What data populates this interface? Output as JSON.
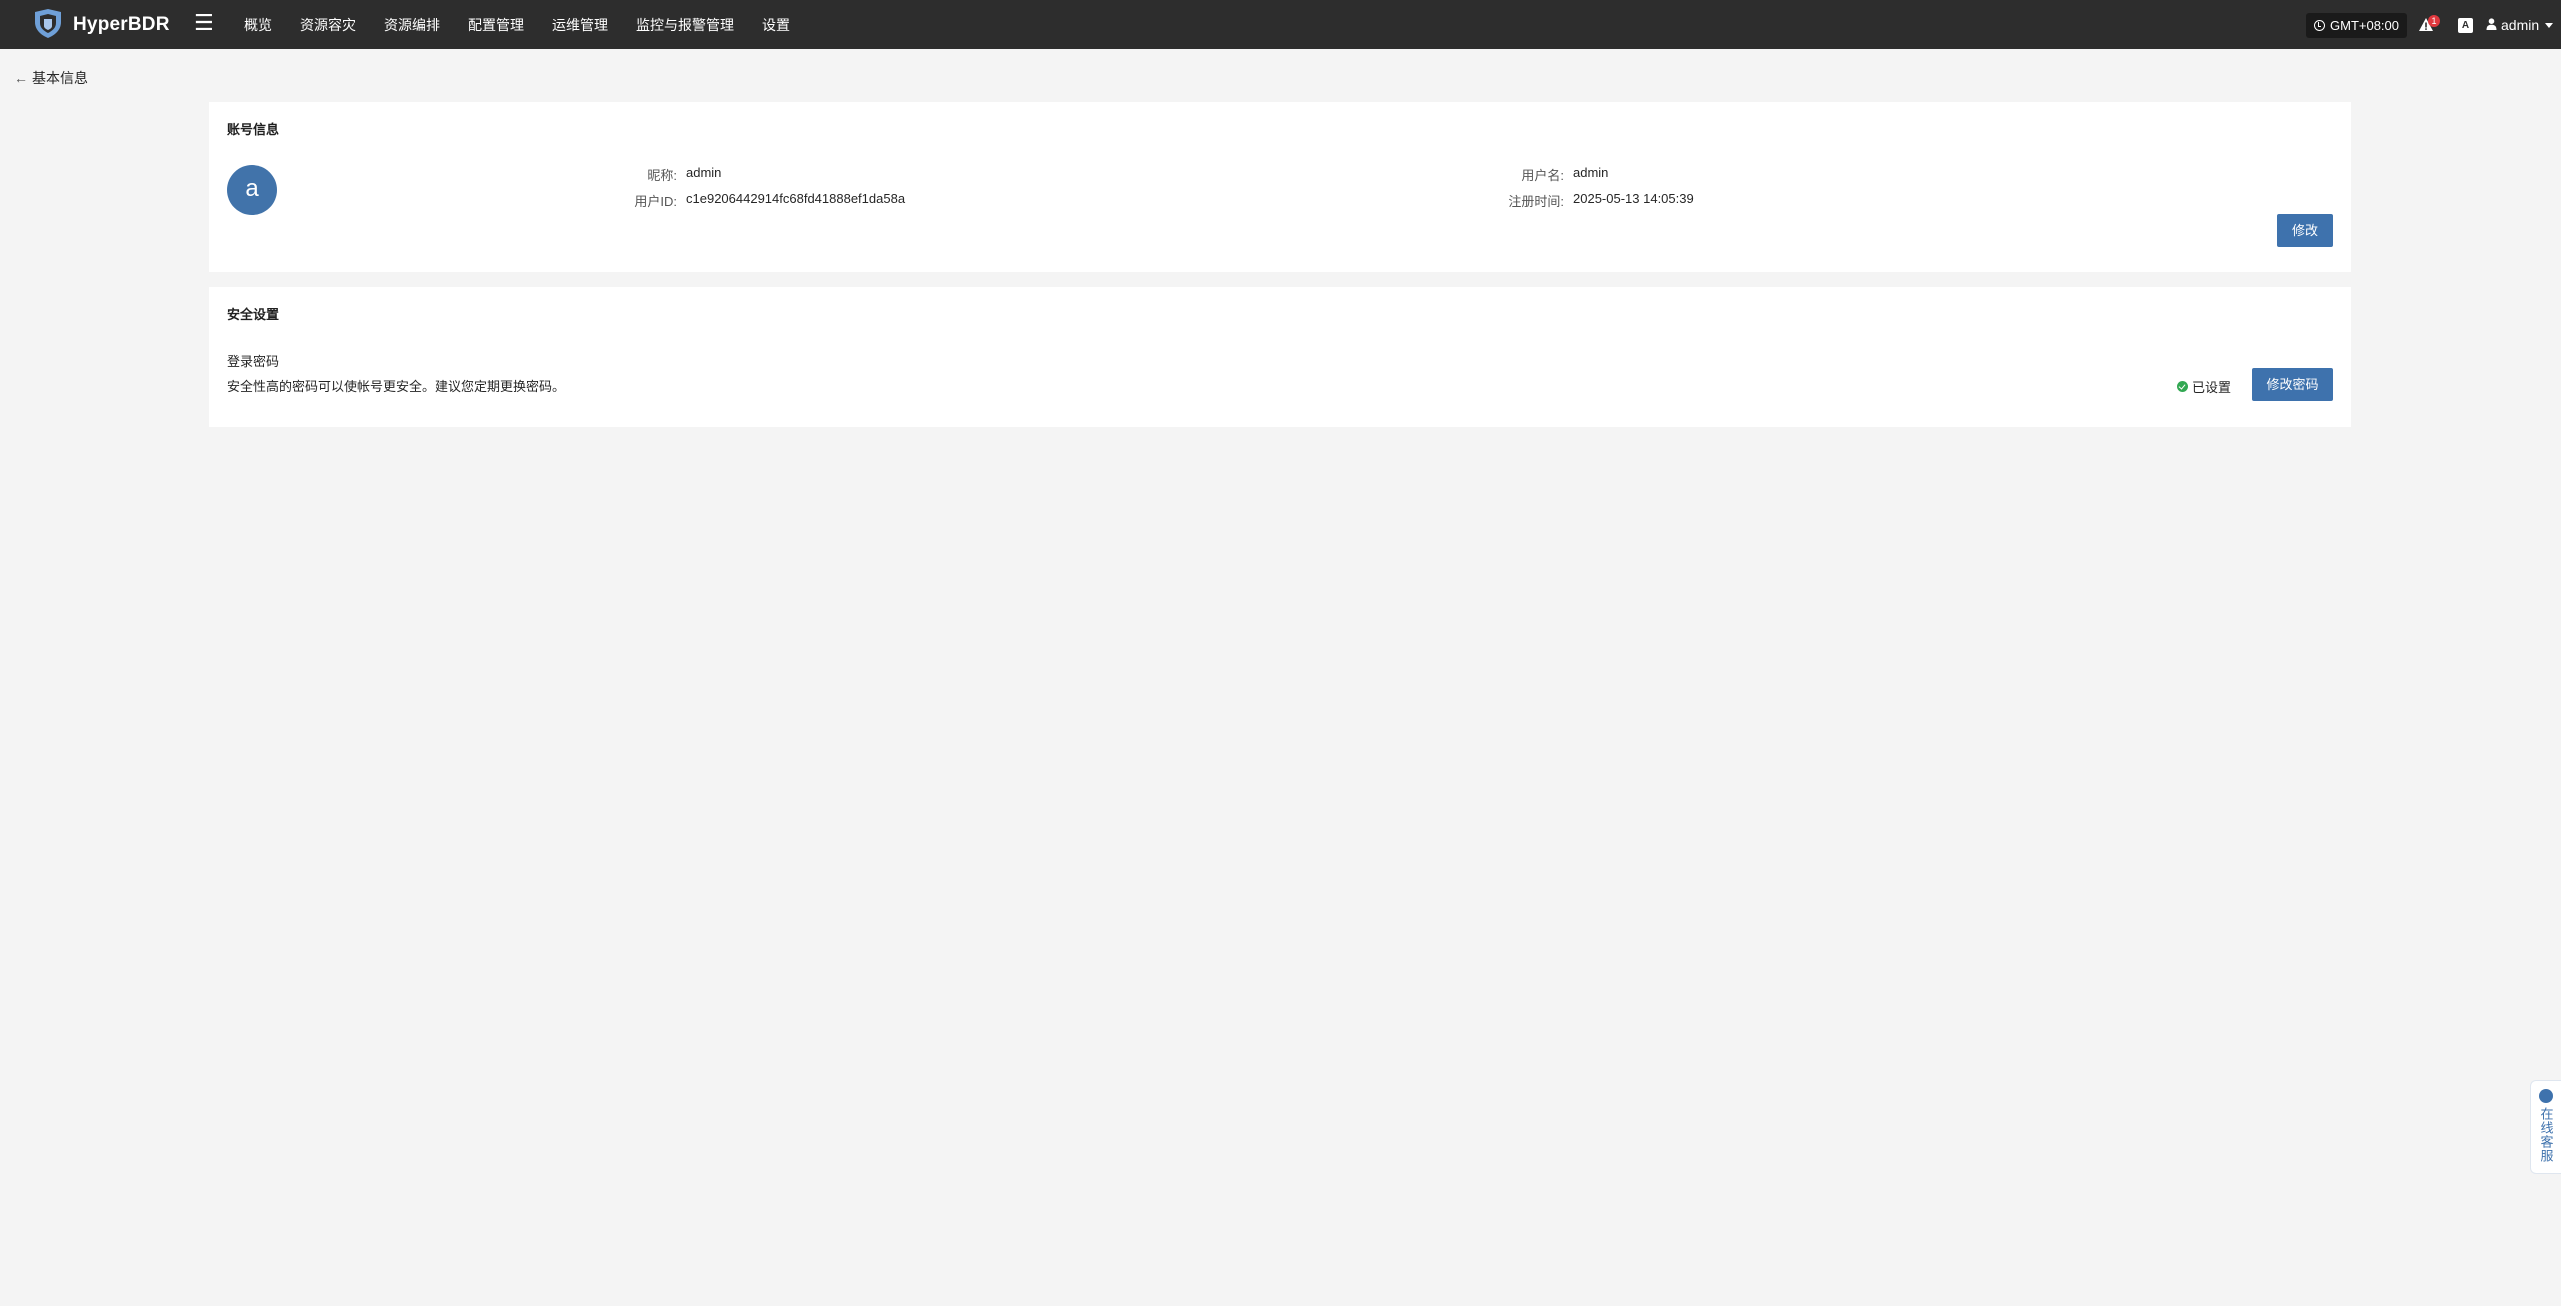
{
  "brand": {
    "name": "HyperBDR",
    "logo_icon": "shield-logo-icon"
  },
  "nav": {
    "menu_icon": "hamburger-icon",
    "items": [
      "概览",
      "资源容灾",
      "资源编排",
      "配置管理",
      "运维管理",
      "监控与报警管理",
      "设置"
    ]
  },
  "header": {
    "timezone": "GMT+08:00",
    "alert_count": "1",
    "lang_glyph": "A",
    "user": "admin"
  },
  "page": {
    "back_label": "基本信息"
  },
  "account": {
    "title": "账号信息",
    "avatar_letter": "a",
    "nickname_label": "昵称:",
    "nickname": "admin",
    "userid_label": "用户ID:",
    "userid": "c1e9206442914fc68fd41888ef1da58a",
    "username_label": "用户名:",
    "username": "admin",
    "registered_label": "注册时间:",
    "registered": "2025-05-13 14:05:39",
    "edit_button": "修改"
  },
  "security": {
    "title": "安全设置",
    "password_title": "登录密码",
    "password_desc": "安全性高的密码可以使帐号更安全。建议您定期更换密码。",
    "status": "已设置",
    "status_color": "#32a852",
    "change_button": "修改密码"
  },
  "support": {
    "label": "在线客服"
  },
  "colors": {
    "accent": "#3e72ad",
    "topbar": "#2d2d2d",
    "page_bg": "#f4f4f4"
  }
}
